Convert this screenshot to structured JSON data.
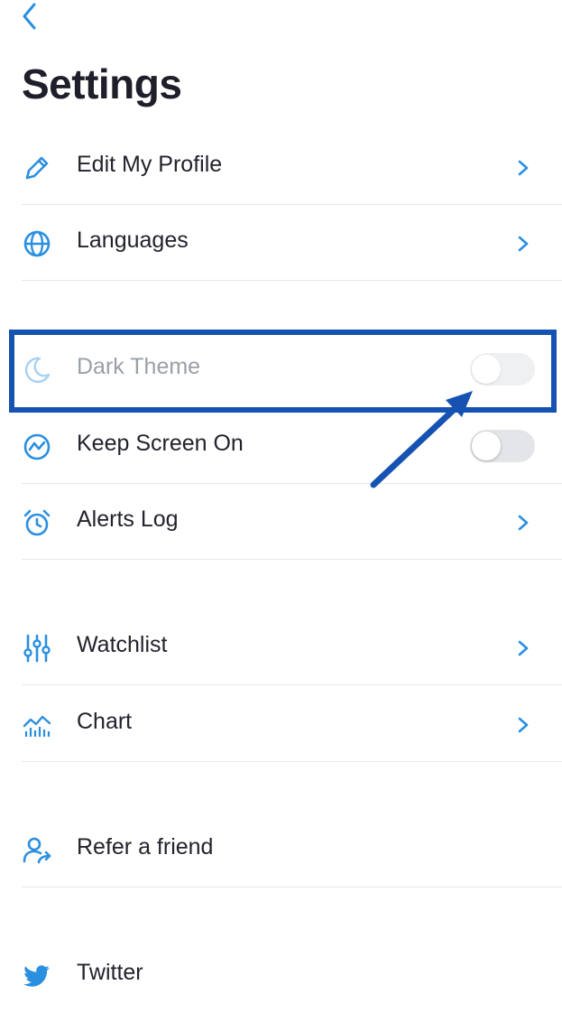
{
  "header": {
    "back_icon": "chevron-left-icon",
    "title": "Settings"
  },
  "colors": {
    "accent": "#2b8fe0",
    "highlight": "#1552b2",
    "toggle_off": "#e3e5e8",
    "divider": "#e6e8ec"
  },
  "items": [
    {
      "label": "Edit My Profile",
      "icon": "pencil-icon",
      "control": "chevron"
    },
    {
      "label": "Languages",
      "icon": "globe-icon",
      "control": "chevron"
    },
    {
      "label": "Dark Theme",
      "icon": "moon-icon",
      "control": "toggle",
      "enabled": false,
      "disabled": true
    },
    {
      "label": "Keep Screen On",
      "icon": "screen-activity-icon",
      "control": "toggle",
      "enabled": false
    },
    {
      "label": "Alerts Log",
      "icon": "alarm-clock-icon",
      "control": "chevron"
    },
    {
      "label": "Watchlist",
      "icon": "sliders-icon",
      "control": "chevron"
    },
    {
      "label": "Chart",
      "icon": "chart-icon",
      "control": "chevron"
    },
    {
      "label": "Refer a friend",
      "icon": "user-share-icon",
      "control": "none"
    },
    {
      "label": "Twitter",
      "icon": "twitter-icon",
      "control": "none"
    }
  ]
}
